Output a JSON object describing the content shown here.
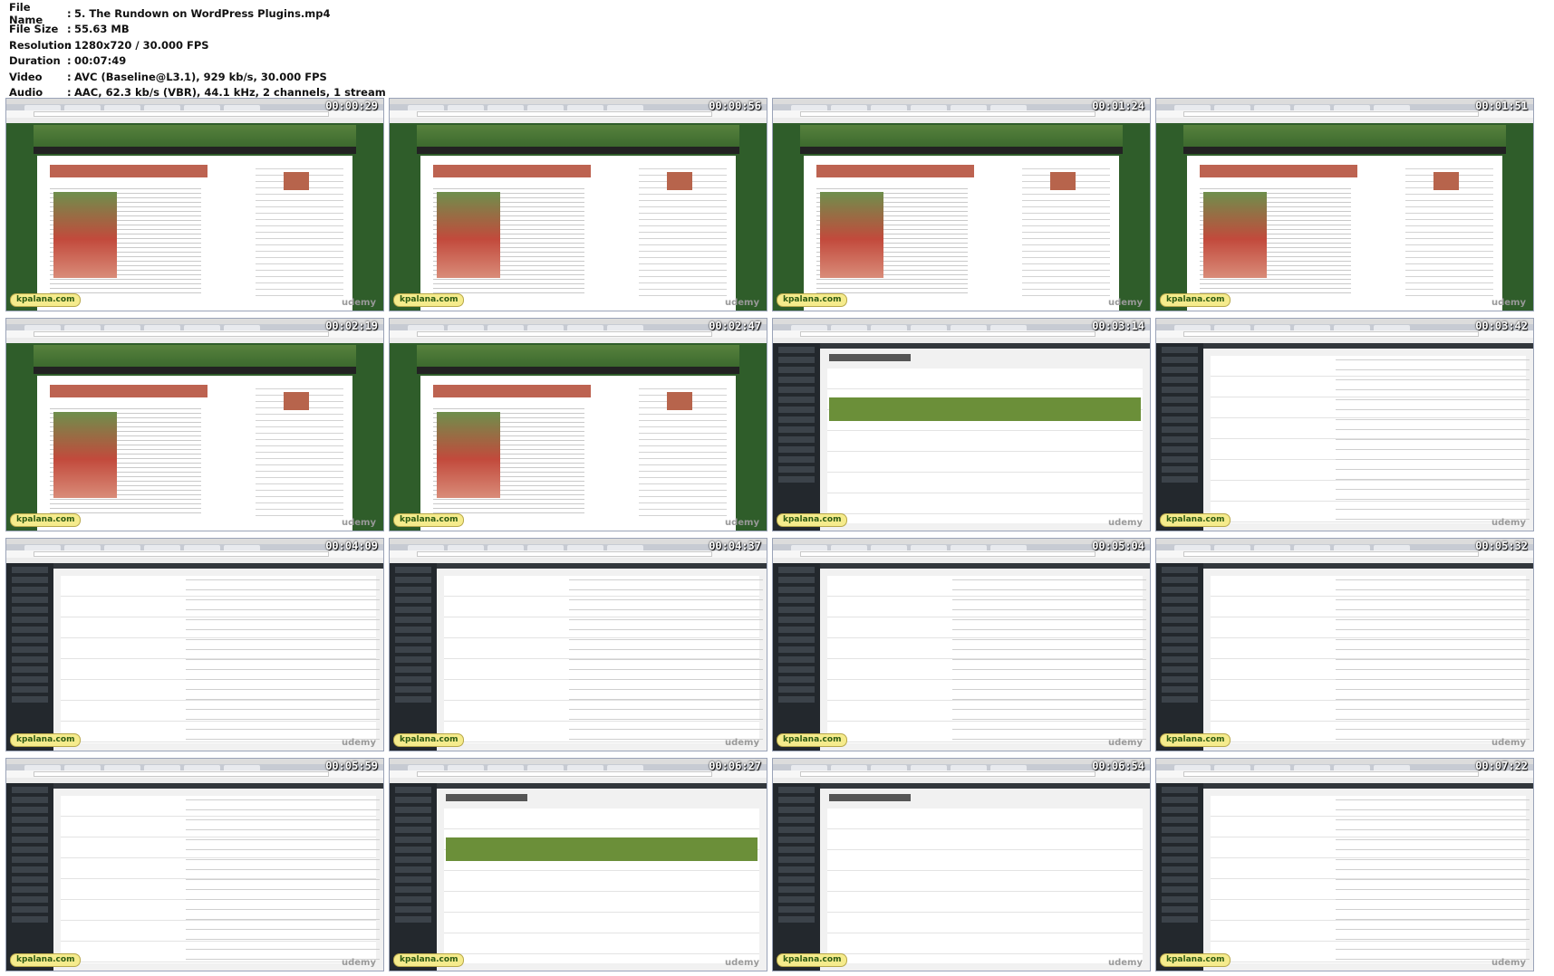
{
  "file_info": [
    {
      "label": "File Name",
      "value": "5. The Rundown on WordPress Plugins.mp4"
    },
    {
      "label": "File Size",
      "value": "55.63 MB"
    },
    {
      "label": "Resolution",
      "value": "1280x720 / 30.000 FPS"
    },
    {
      "label": "Duration",
      "value": "00:07:49"
    },
    {
      "label": "Video",
      "value": "AVC (Baseline@L3.1), 929 kb/s, 30.000 FPS"
    },
    {
      "label": "Audio",
      "value": "AAC, 62.3 kb/s (VBR), 44.1 kHz, 2 channels, 1 stream"
    }
  ],
  "separator": ":",
  "brand": "kpalana.com",
  "watermark": "udemy",
  "thumbnails": [
    {
      "time": "00:00:29",
      "scene": "blog"
    },
    {
      "time": "00:00:56",
      "scene": "blog"
    },
    {
      "time": "00:01:24",
      "scene": "blog"
    },
    {
      "time": "00:01:51",
      "scene": "blog"
    },
    {
      "time": "00:02:19",
      "scene": "blog"
    },
    {
      "time": "00:02:47",
      "scene": "blog"
    },
    {
      "time": "00:03:14",
      "scene": "wp-dashboard"
    },
    {
      "time": "00:03:42",
      "scene": "wp-plugins"
    },
    {
      "time": "00:04:09",
      "scene": "wp-plugins"
    },
    {
      "time": "00:04:37",
      "scene": "wp-plugins"
    },
    {
      "time": "00:05:04",
      "scene": "wp-plugins"
    },
    {
      "time": "00:05:32",
      "scene": "wp-plugins"
    },
    {
      "time": "00:05:59",
      "scene": "wp-plugins"
    },
    {
      "time": "00:06:27",
      "scene": "wp-dashboard"
    },
    {
      "time": "00:06:54",
      "scene": "wp-add"
    },
    {
      "time": "00:07:22",
      "scene": "wp-plugins"
    }
  ],
  "colors": {
    "blog_bg": "#2f5d2a",
    "wp_sidebar": "#23282d",
    "thumb_border": "#9aa3b8"
  }
}
